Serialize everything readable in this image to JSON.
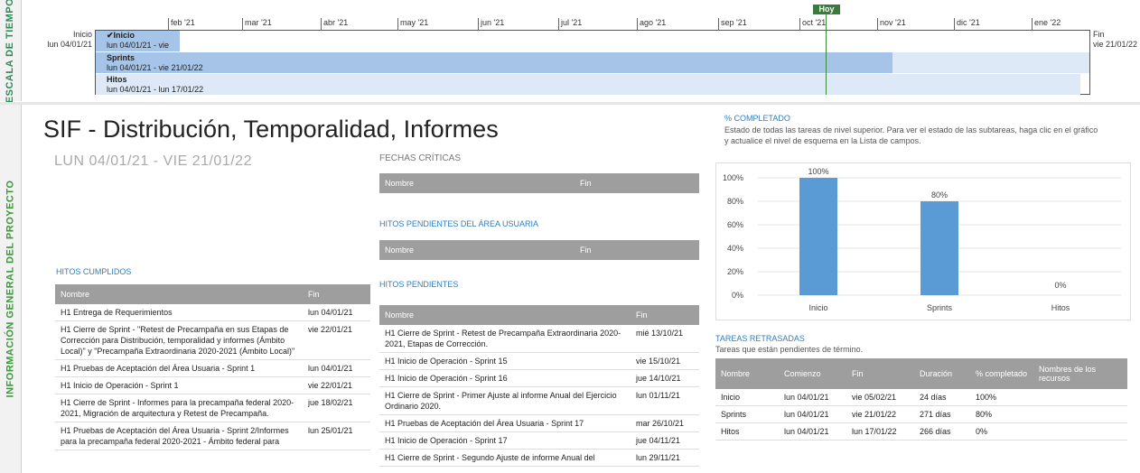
{
  "timeline": {
    "side_label": "ESCALA DE TIEMPO",
    "today_label": "Hoy",
    "start_label": "Inicio",
    "start_date": "lun 04/01/21",
    "end_label": "Fin",
    "end_date": "vie 21/01/22",
    "months": [
      "feb '21",
      "mar '21",
      "abr '21",
      "may '21",
      "jun '21",
      "jul '21",
      "ago '21",
      "sep '21",
      "oct '21",
      "nov '21",
      "dic '21",
      "ene '22"
    ],
    "rows": [
      {
        "title": "Inicio",
        "dates": "lun 04/01/21 - vie"
      },
      {
        "title": "Sprints",
        "dates": "lun 04/01/21 - vie 21/01/22"
      },
      {
        "title": "Hitos",
        "dates": "lun 04/01/21 - lun 17/01/22"
      }
    ]
  },
  "main": {
    "side_label": "INFORMACIÓN GENERAL DEL PROYECTO",
    "title": "SIF - Distribución, Temporalidad, Informes",
    "dates": "LUN 04/01/21 -  VIE 21/01/22"
  },
  "hitos_cumplidos": {
    "heading": "HITOS CUMPLIDOS",
    "columns": [
      "Nombre",
      "Fin"
    ],
    "rows": [
      [
        "H1 Entrega de Requerimientos",
        "lun 04/01/21"
      ],
      [
        "H1 Cierre de Sprint - \"Retest de Precampaña en sus Etapas de Corrección para Distribución, temporalidad y informes (Ámbito Local)\" y \"Precampaña Extraordinaria 2020-2021 (Ámbito Local)\"",
        "vie 22/01/21"
      ],
      [
        "H1 Pruebas de Aceptación del Área Usuaria - Sprint 1",
        "lun 04/01/21"
      ],
      [
        "H1 Inicio de Operación - Sprint 1",
        "vie 22/01/21"
      ],
      [
        "H1 Cierre de Sprint - Informes para la precampaña federal 2020-2021, Migración de arquitectura y Retest de Precampaña.",
        "jue 18/02/21"
      ],
      [
        "H1 Pruebas de Aceptación del Área Usuaria - Sprint 2/Informes para la precampaña federal 2020-2021 - Ámbito federal para",
        "lun 25/01/21"
      ]
    ]
  },
  "fechas_criticas": {
    "heading": "FECHAS CRÍTICAS",
    "columns": [
      "Nombre",
      "Fin"
    ]
  },
  "hitos_pendientes_usuaria": {
    "heading": "HITOS PENDIENTES DEL ÁREA USUARIA",
    "columns": [
      "Nombre",
      "Fin"
    ]
  },
  "hitos_pendientes": {
    "heading": "HITOS PENDIENTES",
    "columns": [
      "Nombre",
      "Fin"
    ],
    "rows": [
      [
        "H1 Cierre de Sprint - Retest de Precampaña Extraordinaria 2020-2021, Etapas de Corrección.",
        "mié 13/10/21"
      ],
      [
        "H1 Inicio de Operación - Sprint 15",
        "vie 15/10/21"
      ],
      [
        "H1 Inicio de Operación - Sprint 16",
        "jue 14/10/21"
      ],
      [
        "H1 Cierre de Sprint - Primer Ajuste al informe Anual del Ejercicio Ordinario 2020.",
        "lun 01/11/21"
      ],
      [
        "H1 Pruebas de Aceptación del Área Usuaria - Sprint 17",
        "mar 26/10/21"
      ],
      [
        "H1 Inicio de Operación - Sprint 17",
        "jue 04/11/21"
      ],
      [
        "H1 Cierre de Sprint - Segundo Ajuste de informe Anual del",
        "lun 29/11/21"
      ]
    ]
  },
  "completado": {
    "heading": "% COMPLETADO",
    "description": "Estado de todas las tareas de nivel superior. Para ver el estado de las subtareas, haga clic en el gráfico y actualice el nivel de esquema en la Lista de campos."
  },
  "chart_data": {
    "type": "bar",
    "categories": [
      "Inicio",
      "Sprints",
      "Hitos"
    ],
    "values": [
      100,
      80,
      0
    ],
    "data_labels": [
      "100%",
      "80%",
      "0%"
    ],
    "ylim": [
      0,
      100
    ],
    "yticks": [
      "0%",
      "20%",
      "40%",
      "60%",
      "80%",
      "100%"
    ],
    "color": "#5b9bd5",
    "grid": true,
    "title": "",
    "xlabel": "",
    "ylabel": ""
  },
  "tareas_retrasadas": {
    "heading": "TAREAS RETRASADAS",
    "subheading": "Tareas que están pendientes de término.",
    "columns": [
      "Nombre",
      "Comienzo",
      "Fin",
      "Duración",
      "% completado",
      "Nombres de los recursos"
    ],
    "rows": [
      [
        "Inicio",
        "lun 04/01/21",
        "vie 05/02/21",
        "24 días",
        "100%",
        ""
      ],
      [
        "Sprints",
        "lun 04/01/21",
        "vie 21/01/22",
        "271 días",
        "80%",
        ""
      ],
      [
        "Hitos",
        "lun 04/01/21",
        "lun 17/01/22",
        "266 días",
        "0%",
        ""
      ]
    ]
  }
}
